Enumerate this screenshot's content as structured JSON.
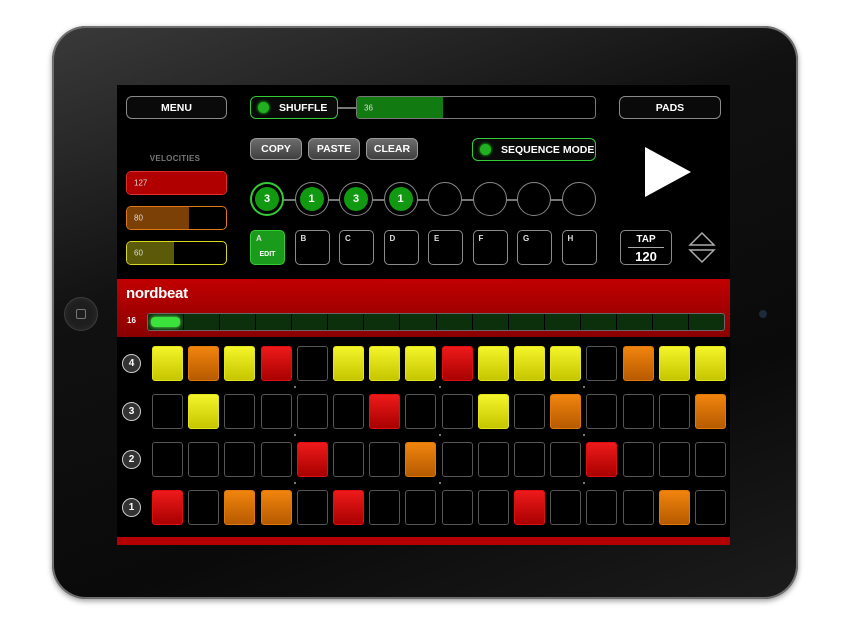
{
  "header": {
    "menu_label": "MENU",
    "shuffle_label": "SHUFFLE",
    "shuffle_value": "36",
    "shuffle_fill_fraction": 0.36,
    "pads_label": "PADS"
  },
  "edit_buttons": {
    "copy": "COPY",
    "paste": "PASTE",
    "clear": "CLEAR"
  },
  "sequence_mode_label": "SEQUENCE MODE",
  "velocities": {
    "title": "VELOCITIES",
    "items": [
      {
        "value": "127",
        "fill_fraction": 1.0,
        "color": "#b00000",
        "border": "#e03030"
      },
      {
        "value": "80",
        "fill_fraction": 0.63,
        "color": "#7a4006",
        "border": "#e07818"
      },
      {
        "value": "60",
        "fill_fraction": 0.47,
        "color": "#5a5a08",
        "border": "#d8d820"
      }
    ]
  },
  "sequence_chain": [
    "3",
    "1",
    "3",
    "1",
    "",
    "",
    "",
    ""
  ],
  "patterns": {
    "labels": [
      "A",
      "B",
      "C",
      "D",
      "E",
      "F",
      "G",
      "H"
    ],
    "active_index": 0,
    "edit_label": "EDIT"
  },
  "tap": {
    "label": "TAP",
    "bpm": "120"
  },
  "brand": "nordbeat",
  "steps_count": "16",
  "playhead_step": 0,
  "tracks": [
    {
      "number": "4",
      "steps": [
        4,
        3,
        4,
        2,
        0,
        4,
        4,
        4,
        2,
        4,
        4,
        4,
        0,
        3,
        4,
        4
      ]
    },
    {
      "number": "3",
      "steps": [
        0,
        4,
        0,
        0,
        0,
        0,
        2,
        0,
        0,
        4,
        0,
        3,
        0,
        0,
        0,
        3
      ]
    },
    {
      "number": "2",
      "steps": [
        0,
        0,
        0,
        0,
        2,
        0,
        0,
        3,
        0,
        0,
        0,
        0,
        2,
        0,
        0,
        0
      ]
    },
    {
      "number": "1",
      "steps": [
        2,
        0,
        3,
        3,
        0,
        2,
        0,
        0,
        0,
        0,
        2,
        0,
        0,
        0,
        3,
        0
      ]
    }
  ],
  "colors": {
    "accent_green": "#33cc33",
    "brand_red": "#c10000",
    "velocity_high": "#ee1a1a",
    "velocity_mid": "#f0840e",
    "velocity_low": "#f4f42a"
  }
}
